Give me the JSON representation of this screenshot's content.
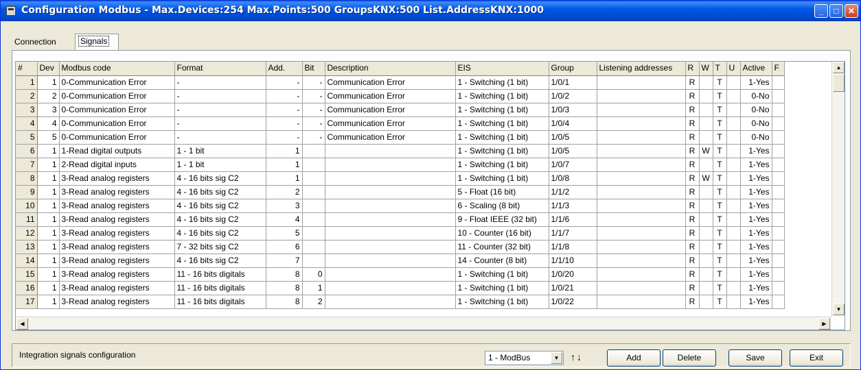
{
  "window": {
    "title": "Configuration Modbus - Max.Devices:254 Max.Points:500 GroupsKNX:500 List.AddressKNX:1000"
  },
  "tabs": [
    {
      "label": "Connection"
    },
    {
      "label": "Signals"
    }
  ],
  "grid": {
    "columns": [
      "#",
      "Dev",
      "Modbus code",
      "Format",
      "Add.",
      "Bit",
      "Description",
      "EIS",
      "Group",
      "Listening addresses",
      "R",
      "W",
      "T",
      "U",
      "Active",
      "F"
    ],
    "rows": [
      {
        "n": "1",
        "dev": "1",
        "code": "0-Communication Error",
        "format": "-",
        "add": "-",
        "bit": "-",
        "desc": "Communication Error",
        "eis": "1 - Switching (1 bit)",
        "group": "1/0/1",
        "listen": "",
        "r": "R",
        "w": "",
        "t": "T",
        "u": "",
        "active": "1-Yes"
      },
      {
        "n": "2",
        "dev": "2",
        "code": "0-Communication Error",
        "format": "-",
        "add": "-",
        "bit": "-",
        "desc": "Communication Error",
        "eis": "1 - Switching (1 bit)",
        "group": "1/0/2",
        "listen": "",
        "r": "R",
        "w": "",
        "t": "T",
        "u": "",
        "active": "0-No"
      },
      {
        "n": "3",
        "dev": "3",
        "code": "0-Communication Error",
        "format": "-",
        "add": "-",
        "bit": "-",
        "desc": "Communication Error",
        "eis": "1 - Switching (1 bit)",
        "group": "1/0/3",
        "listen": "",
        "r": "R",
        "w": "",
        "t": "T",
        "u": "",
        "active": "0-No"
      },
      {
        "n": "4",
        "dev": "4",
        "code": "0-Communication Error",
        "format": "-",
        "add": "-",
        "bit": "-",
        "desc": "Communication Error",
        "eis": "1 - Switching (1 bit)",
        "group": "1/0/4",
        "listen": "",
        "r": "R",
        "w": "",
        "t": "T",
        "u": "",
        "active": "0-No"
      },
      {
        "n": "5",
        "dev": "5",
        "code": "0-Communication Error",
        "format": "-",
        "add": "-",
        "bit": "-",
        "desc": "Communication Error",
        "eis": "1 - Switching (1 bit)",
        "group": "1/0/5",
        "listen": "",
        "r": "R",
        "w": "",
        "t": "T",
        "u": "",
        "active": "0-No"
      },
      {
        "n": "6",
        "dev": "1",
        "code": "1-Read digital outputs",
        "format": "1 - 1 bit",
        "add": "1",
        "bit": "",
        "desc": "",
        "eis": "1 - Switching (1 bit)",
        "group": "1/0/5",
        "listen": "",
        "r": "R",
        "w": "W",
        "t": "T",
        "u": "",
        "active": "1-Yes"
      },
      {
        "n": "7",
        "dev": "1",
        "code": "2-Read digital inputs",
        "format": "1 - 1 bit",
        "add": "1",
        "bit": "",
        "desc": "",
        "eis": "1 - Switching (1 bit)",
        "group": "1/0/7",
        "listen": "",
        "r": "R",
        "w": "",
        "t": "T",
        "u": "",
        "active": "1-Yes"
      },
      {
        "n": "8",
        "dev": "1",
        "code": "3-Read analog registers",
        "format": "4 - 16 bits sig C2",
        "add": "1",
        "bit": "",
        "desc": "",
        "eis": "1 - Switching (1 bit)",
        "group": "1/0/8",
        "listen": "",
        "r": "R",
        "w": "W",
        "t": "T",
        "u": "",
        "active": "1-Yes"
      },
      {
        "n": "9",
        "dev": "1",
        "code": "3-Read analog registers",
        "format": "4 - 16 bits sig C2",
        "add": "2",
        "bit": "",
        "desc": "",
        "eis": "5 - Float (16 bit)",
        "group": "1/1/2",
        "listen": "",
        "r": "R",
        "w": "",
        "t": "T",
        "u": "",
        "active": "1-Yes"
      },
      {
        "n": "10",
        "dev": "1",
        "code": "3-Read analog registers",
        "format": "4 - 16 bits sig C2",
        "add": "3",
        "bit": "",
        "desc": "",
        "eis": "6 - Scaling (8 bit)",
        "group": "1/1/3",
        "listen": "",
        "r": "R",
        "w": "",
        "t": "T",
        "u": "",
        "active": "1-Yes"
      },
      {
        "n": "11",
        "dev": "1",
        "code": "3-Read analog registers",
        "format": "4 - 16 bits sig C2",
        "add": "4",
        "bit": "",
        "desc": "",
        "eis": "9 - Float IEEE (32 bit)",
        "group": "1/1/6",
        "listen": "",
        "r": "R",
        "w": "",
        "t": "T",
        "u": "",
        "active": "1-Yes"
      },
      {
        "n": "12",
        "dev": "1",
        "code": "3-Read analog registers",
        "format": "4 - 16 bits sig C2",
        "add": "5",
        "bit": "",
        "desc": "",
        "eis": "10 - Counter (16 bit)",
        "group": "1/1/7",
        "listen": "",
        "r": "R",
        "w": "",
        "t": "T",
        "u": "",
        "active": "1-Yes"
      },
      {
        "n": "13",
        "dev": "1",
        "code": "3-Read analog registers",
        "format": "7 - 32 bits sig C2",
        "add": "6",
        "bit": "",
        "desc": "",
        "eis": "11 - Counter (32 bit)",
        "group": "1/1/8",
        "listen": "",
        "r": "R",
        "w": "",
        "t": "T",
        "u": "",
        "active": "1-Yes"
      },
      {
        "n": "14",
        "dev": "1",
        "code": "3-Read analog registers",
        "format": "4 - 16 bits sig C2",
        "add": "7",
        "bit": "",
        "desc": "",
        "eis": "14 - Counter (8 bit)",
        "group": "1/1/10",
        "listen": "",
        "r": "R",
        "w": "",
        "t": "T",
        "u": "",
        "active": "1-Yes"
      },
      {
        "n": "15",
        "dev": "1",
        "code": "3-Read analog registers",
        "format": "11 - 16 bits digitals",
        "add": "8",
        "bit": "0",
        "desc": "",
        "eis": "1 - Switching (1 bit)",
        "group": "1/0/20",
        "listen": "",
        "r": "R",
        "w": "",
        "t": "T",
        "u": "",
        "active": "1-Yes"
      },
      {
        "n": "16",
        "dev": "1",
        "code": "3-Read analog registers",
        "format": "11 - 16 bits digitals",
        "add": "8",
        "bit": "1",
        "desc": "",
        "eis": "1 - Switching (1 bit)",
        "group": "1/0/21",
        "listen": "",
        "r": "R",
        "w": "",
        "t": "T",
        "u": "",
        "active": "1-Yes"
      },
      {
        "n": "17",
        "dev": "1",
        "code": "3-Read analog registers",
        "format": "11 - 16 bits digitals",
        "add": "8",
        "bit": "2",
        "desc": "",
        "eis": "1 - Switching (1 bit)",
        "group": "1/0/22",
        "listen": "",
        "r": "R",
        "w": "",
        "t": "T",
        "u": "",
        "active": "1-Yes"
      }
    ]
  },
  "status": {
    "text": "Integration signals configuration"
  },
  "footer": {
    "protocol_selected": "1 - ModBus",
    "sort_arrows": "↑↓",
    "add_label": "Add",
    "delete_label": "Delete",
    "save_label": "Save",
    "exit_label": "Exit"
  }
}
